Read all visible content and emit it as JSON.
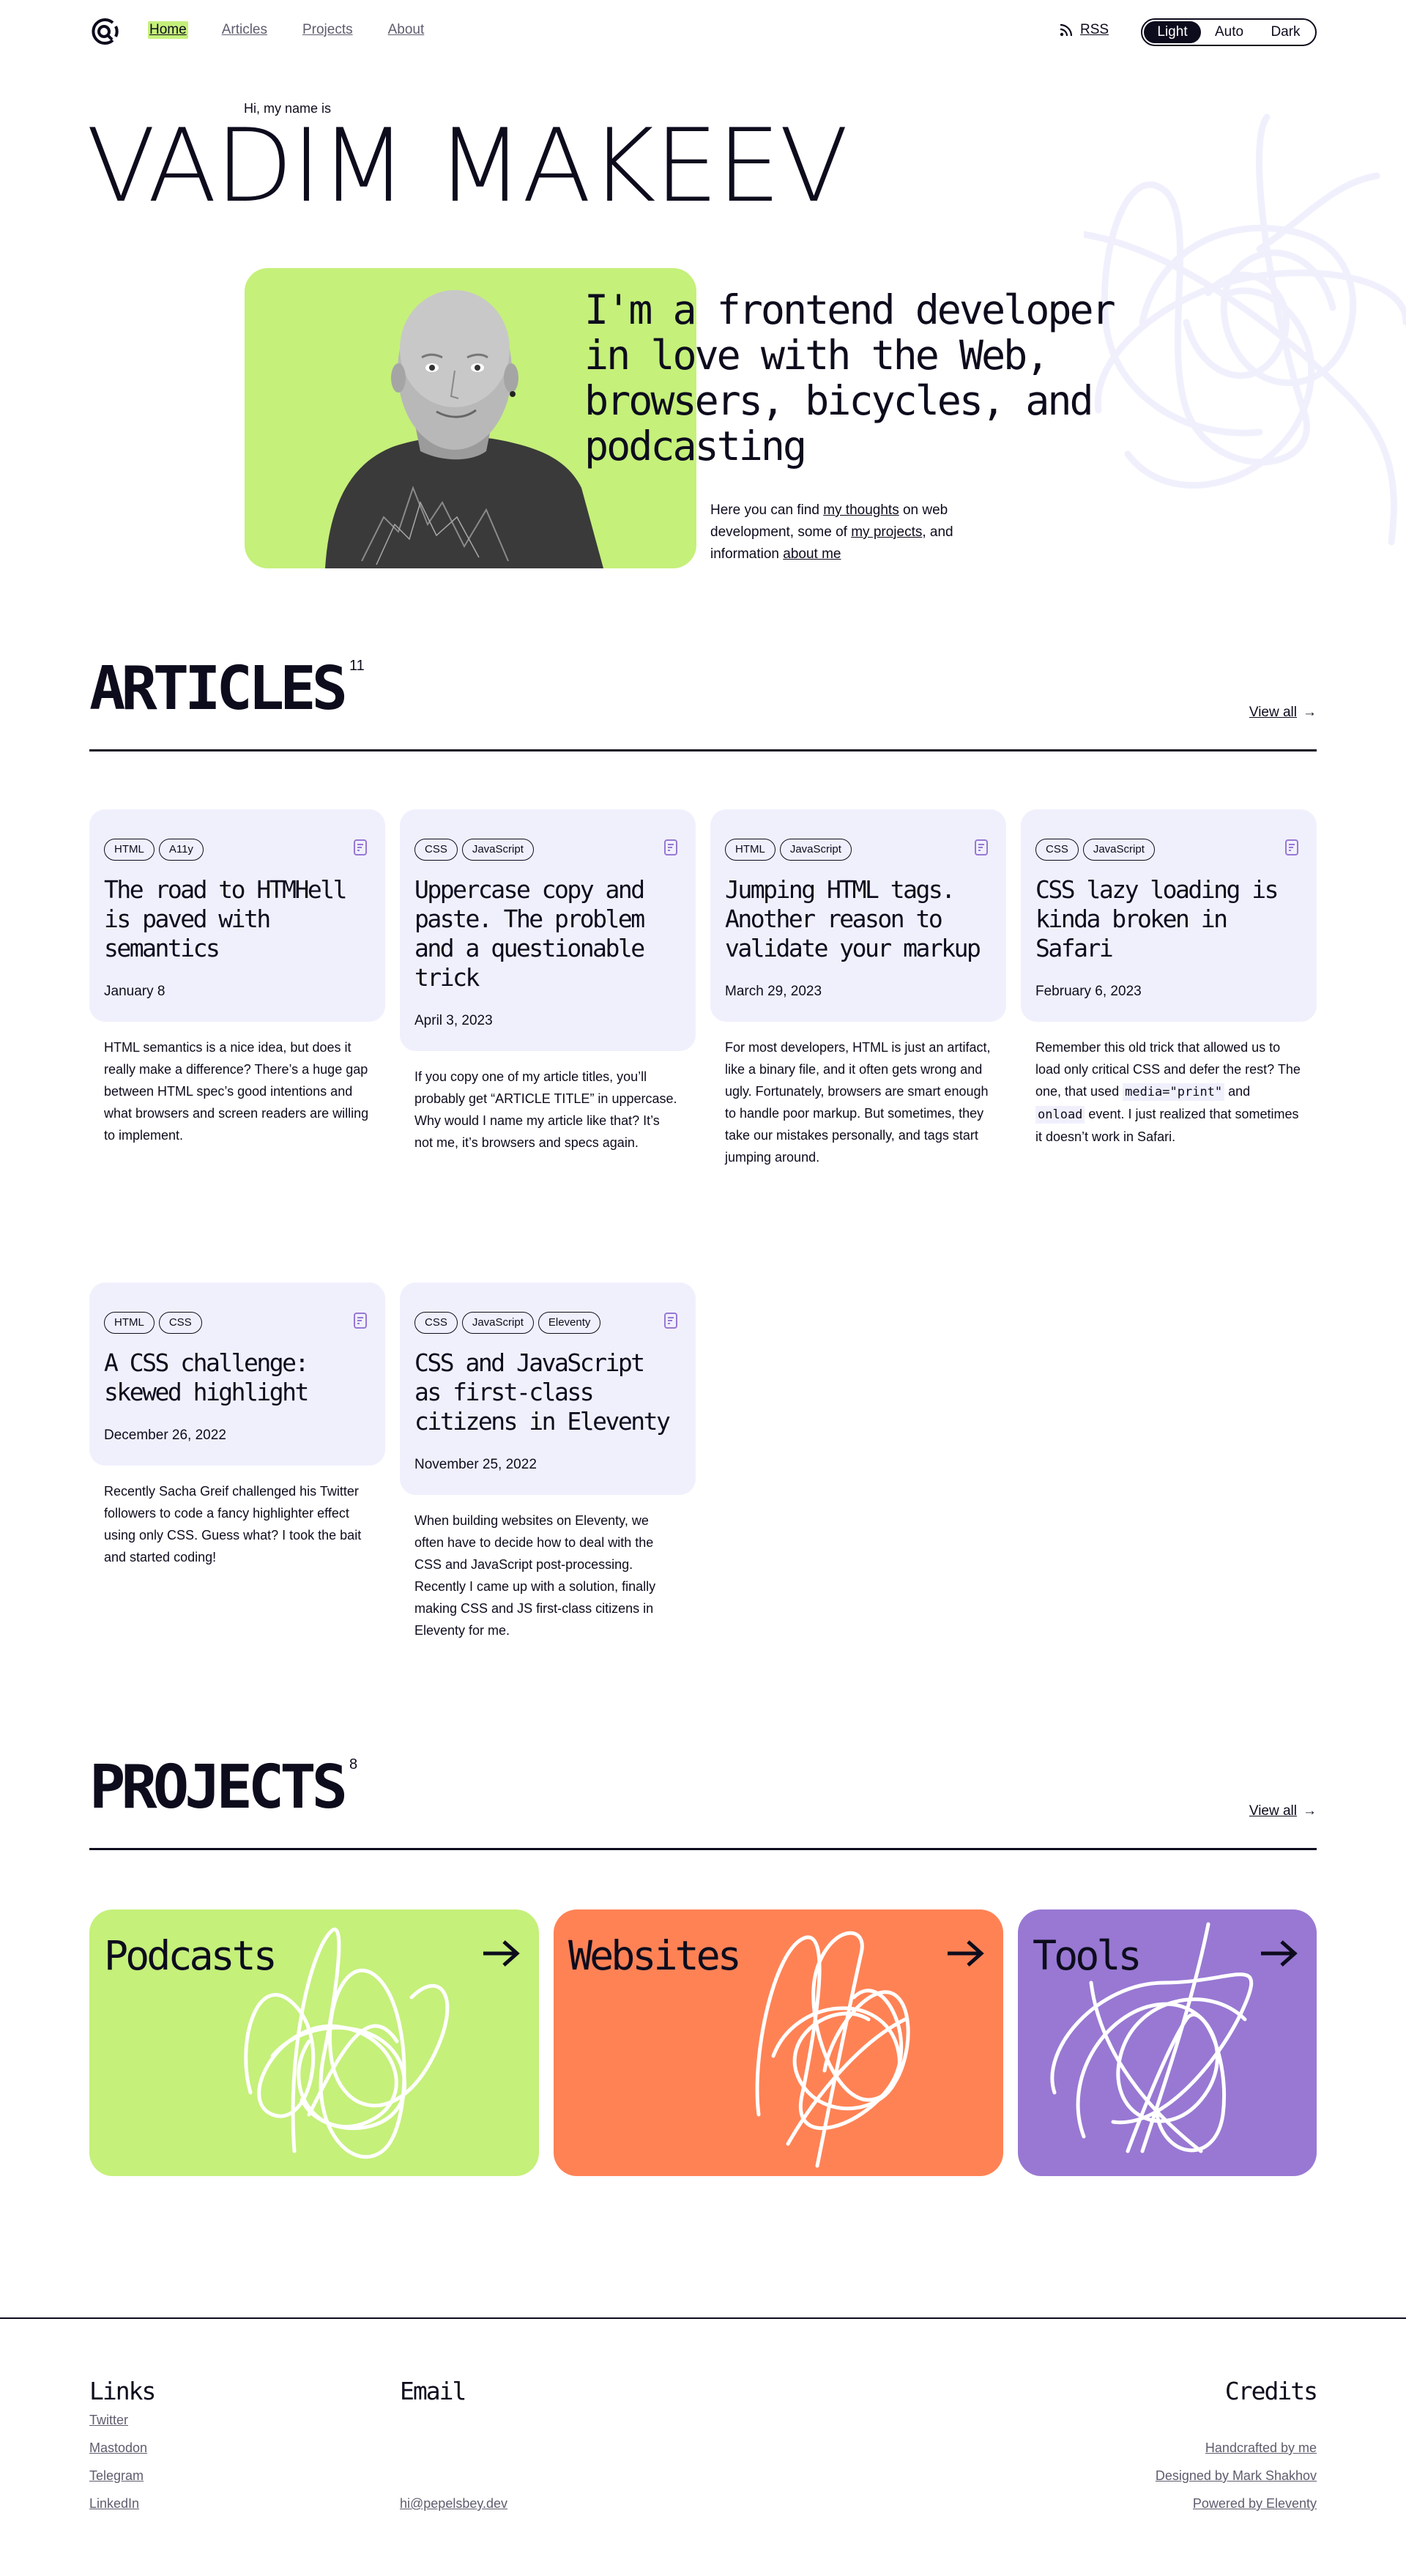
{
  "header": {
    "nav": [
      {
        "label": "Home",
        "active": true
      },
      {
        "label": "Articles",
        "active": false
      },
      {
        "label": "Projects",
        "active": false
      },
      {
        "label": "About",
        "active": false
      }
    ],
    "rss_label": "RSS",
    "theme_options": [
      "Light",
      "Auto",
      "Dark"
    ],
    "theme_selected": "Light"
  },
  "hero": {
    "greeting": "Hi, my name is",
    "name": "VADIM MAKEEV",
    "tagline": "I'm a frontend developer in love with the Web, browsers, bicycles, and podcasting",
    "intro": {
      "t1": "Here you can find ",
      "link1": "my thoughts",
      "t2": " on web development, some of ",
      "link2": "my projects",
      "t3": ", and information ",
      "link3": "about me"
    }
  },
  "articles_section": {
    "title": "ARTICLES",
    "count": "11",
    "view_all": "View all"
  },
  "articles": [
    {
      "tags": [
        "HTML",
        "A11y"
      ],
      "title": "The road to HTMHell is paved with semantics",
      "date": "January 8",
      "excerpt": "HTML semantics is a nice idea, but does it really make a difference? There’s a huge gap between HTML spec’s good intentions and what browsers and screen readers are willing to implement."
    },
    {
      "tags": [
        "CSS",
        "JavaScript"
      ],
      "title": "Uppercase copy and paste. The problem and a questionable trick",
      "date": "April 3, 2023",
      "excerpt": "If you copy one of my article titles, you’ll probably get “ARTICLE TITLE” in uppercase. Why would I name my article like that? It’s not me, it’s browsers and specs again."
    },
    {
      "tags": [
        "HTML",
        "JavaScript"
      ],
      "title": "Jumping HTML tags. Another reason to validate your markup",
      "date": "March 29, 2023",
      "excerpt": "For most developers, HTML is just an artifact, like a binary file, and it often gets wrong and ugly. Fortunately, browsers are smart enough to handle poor markup. But sometimes, they take our mistakes personally, and tags start jumping around."
    },
    {
      "tags": [
        "CSS",
        "JavaScript"
      ],
      "title": "CSS lazy loading is kinda broken in Safari",
      "date": "February 6, 2023",
      "excerpt_parts": {
        "a": "Remember this old trick that allowed us to load only critical CSS and defer the rest? The one, that used ",
        "code1": "media=\"print\"",
        "b": " and ",
        "code2": "onload",
        "c": " event. I just realized that sometimes it doesn’t work in Safari."
      }
    },
    {
      "tags": [
        "HTML",
        "CSS"
      ],
      "title": "A CSS challenge: skewed highlight",
      "date": "December 26, 2022",
      "excerpt": "Recently Sacha Greif challenged his Twitter followers to code a fancy highlighter effect using only CSS. Guess what? I took the bait and started coding!"
    },
    {
      "tags": [
        "CSS",
        "JavaScript",
        "Eleventy"
      ],
      "title": "CSS and JavaScript as first-class citizens in Eleventy",
      "date": "November 25, 2022",
      "excerpt": "When building websites on Eleventy, we often have to decide how to deal with the CSS and JavaScript post-processing. Recently I came up with a solution, finally making CSS and JS first-class citizens in Eleventy for me."
    }
  ],
  "projects_section": {
    "title": "PROJECTS",
    "count": "8",
    "view_all": "View all"
  },
  "projects": [
    {
      "label": "Podcasts",
      "color": "#c5f07a"
    },
    {
      "label": "Websites",
      "color": "#ff8255"
    },
    {
      "label": "Tools",
      "color": "#9878d3"
    }
  ],
  "footer": {
    "links_title": "Links",
    "links": [
      "Twitter",
      "Mastodon",
      "Telegram",
      "LinkedIn"
    ],
    "email_title": "Email",
    "email": "hi@pepelsbey.dev",
    "credits_title": "Credits",
    "credits": [
      "Handcrafted by me",
      "Designed by Mark Shakhov",
      "Powered by Eleventy"
    ]
  },
  "colors": {
    "ink": "#0d0c1d",
    "accent_green": "#c5f07a",
    "card_bg": "#f0f0fd",
    "muted_link": "#5e5d6e",
    "doc_icon": "#9878d3"
  }
}
